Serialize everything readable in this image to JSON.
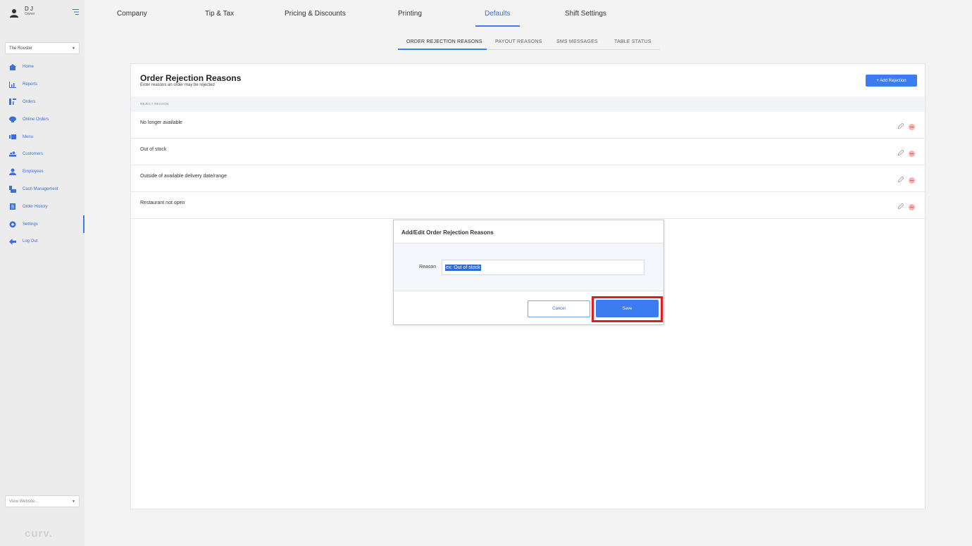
{
  "user": {
    "name": "D J",
    "role": "Owner"
  },
  "location": {
    "selected": "The Rooster"
  },
  "nav": [
    {
      "label": "Home",
      "icon": "home-icon"
    },
    {
      "label": "Reports",
      "icon": "chart-icon"
    },
    {
      "label": "Orders",
      "icon": "orders-icon"
    },
    {
      "label": "Online Orders",
      "icon": "chef-hat-icon"
    },
    {
      "label": "Menu",
      "icon": "menu-icon"
    },
    {
      "label": "Customers",
      "icon": "customers-icon"
    },
    {
      "label": "Employees",
      "icon": "employee-icon"
    },
    {
      "label": "Cash Management",
      "icon": "cash-icon"
    },
    {
      "label": "Order History",
      "icon": "history-icon"
    },
    {
      "label": "Settings",
      "icon": "gear-icon"
    },
    {
      "label": "Log Out",
      "icon": "arrow-left-icon"
    }
  ],
  "website_select": {
    "selected": "View Website..."
  },
  "brand": "curv.",
  "top_tabs": [
    "Company",
    "Tip & Tax",
    "Pricing & Discounts",
    "Printing",
    "Defaults",
    "Shift Settings"
  ],
  "sub_tabs": [
    "ORDER REJECTION REASONS",
    "PAYOUT REASONS",
    "SMS MESSAGES",
    "TABLE STATUS"
  ],
  "card": {
    "title": "Order Rejection Reasons",
    "subtitle": "Enter reasons an order may be rejected",
    "add_button": "+ Add Rejection",
    "column_header": "REJECT REASON",
    "rows": [
      "No longer available",
      "Out of stock",
      "Outside of available delivery date/range",
      "Restaurant not open"
    ]
  },
  "modal": {
    "title": "Add/Edit Order Rejection Reasons",
    "label": "Reason",
    "value": "ex: Out of stock",
    "cancel": "Cancel",
    "save": "Save"
  },
  "colors": {
    "accent": "#3b7cf0",
    "highlight": "#d61f26"
  }
}
